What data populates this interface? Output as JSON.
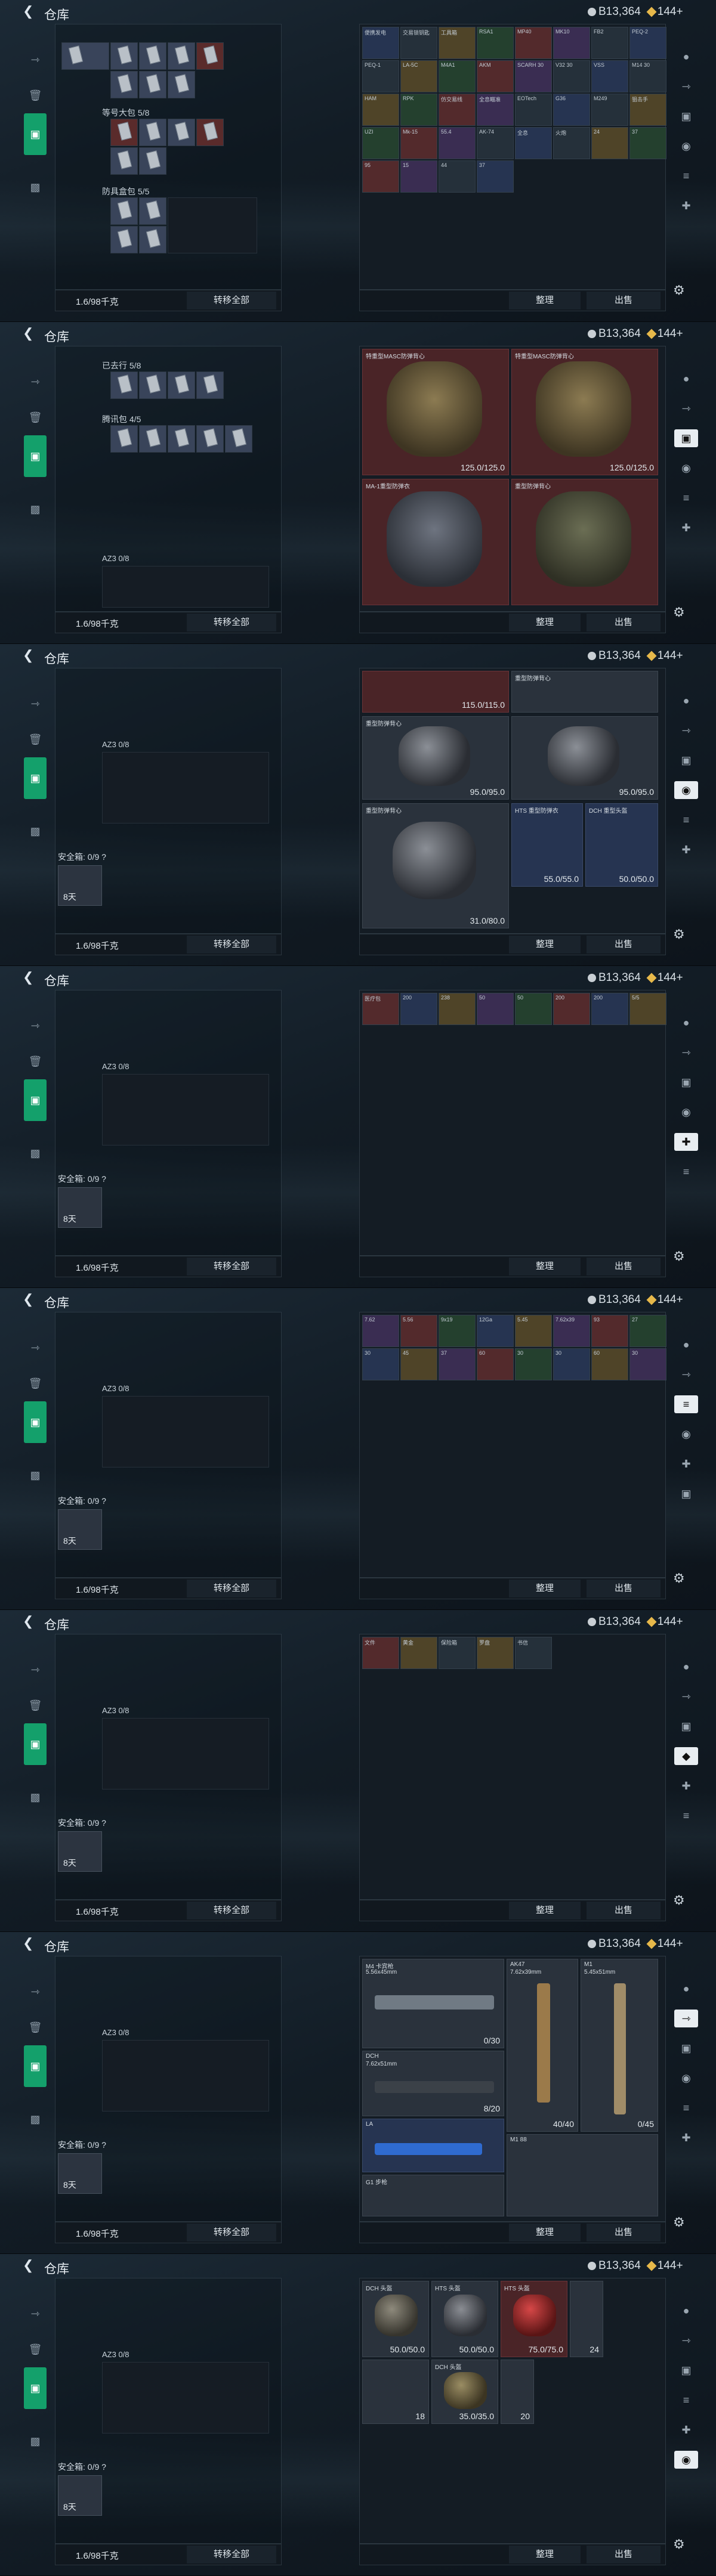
{
  "app": {
    "title": "仓库",
    "currency": "B13,364",
    "gems": "144+",
    "weight": "1.6/98千克",
    "transfer": "转移全部",
    "sort": "整理",
    "sell": "出售"
  },
  "frames": [
    {
      "bags": [
        {
          "label": "等号大包 5/8"
        },
        {
          "label": "防具盒包 5/5"
        }
      ],
      "items": [
        "便携发电",
        "交易锁钥匙",
        "工具箱",
        "RSA1",
        "MP40",
        "MK10",
        "FB2",
        "PEQ-2",
        "PEQ-1",
        "LA-5C",
        "M4A1",
        "AKM",
        "SCARH 30",
        "V32 30",
        "VSS",
        "M14 30",
        "HAM",
        "RPK",
        "仿交易线",
        "全息瞄准",
        "EOTech",
        "G36",
        "M249",
        "狙击手",
        "UZI",
        "Mk-15",
        "55.4",
        "AK-74",
        "全息",
        "火炮",
        "24",
        "37",
        "95",
        "15",
        "44",
        "37"
      ]
    },
    {
      "bags": [
        {
          "label": "已去行 5/8"
        },
        {
          "label": "腾讯包 4/5"
        }
      ],
      "items": [
        {
          "name": "特重型MASC防弹背心",
          "dur": "125.0/125.0"
        },
        {
          "name": "特重型MASC防弹背心",
          "dur": "125.0/125.0"
        },
        {
          "name": "MA-1重型防弹衣",
          "dur": ""
        },
        {
          "name": "重型防弹背心",
          "dur": ""
        }
      ],
      "az": "AZ3 0/8"
    },
    {
      "az": "AZ3 0/8",
      "safe": "安全箱: 0/9 ?",
      "time": "8天",
      "items": [
        {
          "name": "",
          "dur": "115.0/115.0"
        },
        {
          "name": "重型防弹背心",
          "dur": ""
        },
        {
          "name": "重型防弹背心",
          "dur": "95.0/95.0"
        },
        {
          "name": "",
          "dur": "95.0/95.0"
        },
        {
          "name": "重型防弹背心",
          "dur": "31.0/80.0"
        },
        {
          "name": "HTS 重型防弹衣",
          "dur": "55.0/55.0"
        },
        {
          "name": "DCH 重型头盔",
          "dur": "50.0/50.0"
        }
      ]
    },
    {
      "az": "AZ3 0/8",
      "safe": "安全箱: 0/9 ?",
      "time": "8天",
      "items": [
        "医疗包",
        "200",
        "238",
        "50",
        "50",
        "200",
        "200",
        "5/5"
      ]
    },
    {
      "az": "AZ3 0/8",
      "safe": "安全箱: 0/9 ?",
      "time": "8天",
      "items": [
        "7.62",
        "5.56",
        "9x19",
        "12Ga",
        "5.45",
        "7.62x39",
        "93",
        "27",
        "30",
        "45",
        "37",
        "60",
        "30",
        "30",
        "60",
        "30"
      ]
    },
    {
      "az": "AZ3 0/8",
      "safe": "安全箱: 0/9 ?",
      "time": "8天",
      "items": [
        "文件",
        "黄金",
        "保险箱",
        "罗盘",
        "书信"
      ]
    },
    {
      "az": "AZ3 0/8",
      "safe": "安全箱: 0/9 ?",
      "time": "8天",
      "items": [
        {
          "name": "M4 卡宾枪",
          "sub": "5.56x45mm"
        },
        {
          "name": "AK47",
          "sub": "7.62x39mm"
        },
        {
          "name": "M1",
          "sub": "5.45x51mm"
        },
        {
          "name": "DCH",
          "sub": "7.62x51mm"
        },
        {
          "name": "LA",
          "sub": "5.45"
        },
        {
          "name": "40/40"
        },
        {
          "name": "0/30"
        },
        {
          "name": "8/20"
        },
        {
          "name": "0/45"
        },
        {
          "name": "G1 步枪"
        },
        {
          "name": "M1 88"
        }
      ]
    },
    {
      "az": "AZ3 0/8",
      "safe": "安全箱: 0/9 ?",
      "time": "8天",
      "items": [
        {
          "name": "DCH 头盔",
          "dur": "50.0/50.0"
        },
        {
          "name": "HTS 头盔",
          "dur": "50.0/50.0"
        },
        {
          "name": "HTS 头盔",
          "dur": "75.0/75.0"
        },
        {
          "name": "DCH 头盔",
          "dur": "35.0/35.0"
        },
        {
          "name": "24"
        },
        {
          "name": "18"
        },
        {
          "name": "20"
        }
      ]
    }
  ]
}
